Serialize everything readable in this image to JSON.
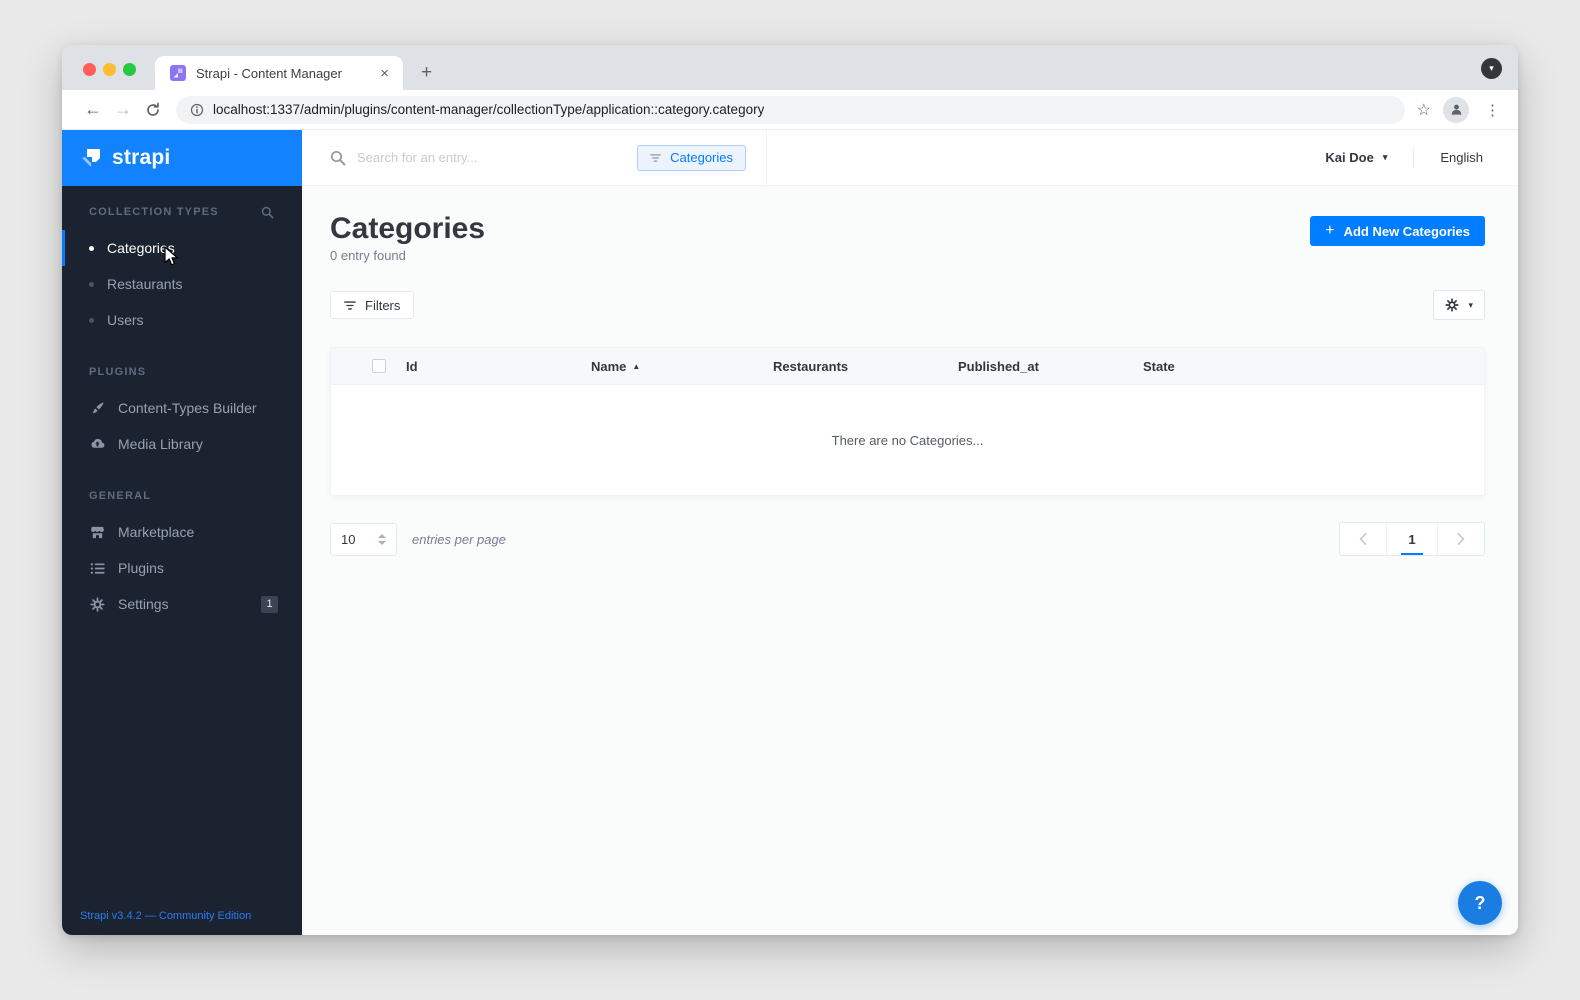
{
  "browser": {
    "tab_title": "Strapi - Content Manager",
    "url": "localhost:1337/admin/plugins/content-manager/collectionType/application::category.category"
  },
  "glyphs": {
    "caret_down": "▾",
    "plus": "+",
    "close": "×",
    "new_tab": "+",
    "back": "←",
    "forward": "→",
    "star": "☆",
    "menu_dots": "⋮",
    "sort_asc": "▲",
    "help": "?"
  },
  "sidebar": {
    "logo_text": "strapi",
    "version": "Strapi v3.4.2 — Community Edition",
    "collection_types": {
      "title": "COLLECTION TYPES",
      "items": [
        {
          "label": "Categories",
          "active": true
        },
        {
          "label": "Restaurants",
          "active": false
        },
        {
          "label": "Users",
          "active": false
        }
      ]
    },
    "plugins_section": {
      "title": "PLUGINS",
      "items": [
        {
          "label": "Content-Types Builder",
          "icon": "brush-icon"
        },
        {
          "label": "Media Library",
          "icon": "cloud-upload-icon"
        }
      ]
    },
    "general_section": {
      "title": "GENERAL",
      "items": [
        {
          "label": "Marketplace",
          "icon": "shop-icon"
        },
        {
          "label": "Plugins",
          "icon": "list-icon"
        },
        {
          "label": "Settings",
          "icon": "gear-icon",
          "badge": "1"
        }
      ]
    }
  },
  "topbar": {
    "search_placeholder": "Search for an entry...",
    "filter_chip_label": "Categories",
    "user_name": "Kai Doe",
    "locale": "English"
  },
  "page": {
    "title": "Categories",
    "subtitle": "0 entry found",
    "add_button_label": "Add New Categories",
    "filters_button_label": "Filters",
    "empty_message": "There are no Categories...",
    "entries_per_page_value": "10",
    "entries_per_page_label": "entries per page",
    "current_page": "1"
  },
  "table": {
    "columns": [
      "Id",
      "Name",
      "Restaurants",
      "Published_at",
      "State"
    ],
    "sort_column": "Name",
    "sort_direction": "asc",
    "rows": []
  },
  "colors": {
    "brand_blue": "#007eff",
    "logo_header_blue": "#1282ff",
    "sidebar_bg": "#1b2330",
    "content_bg": "#fafbfb",
    "badge_bg": "#3b4354",
    "chip_bg": "#ecf3fd",
    "chip_border": "#add0f8"
  }
}
